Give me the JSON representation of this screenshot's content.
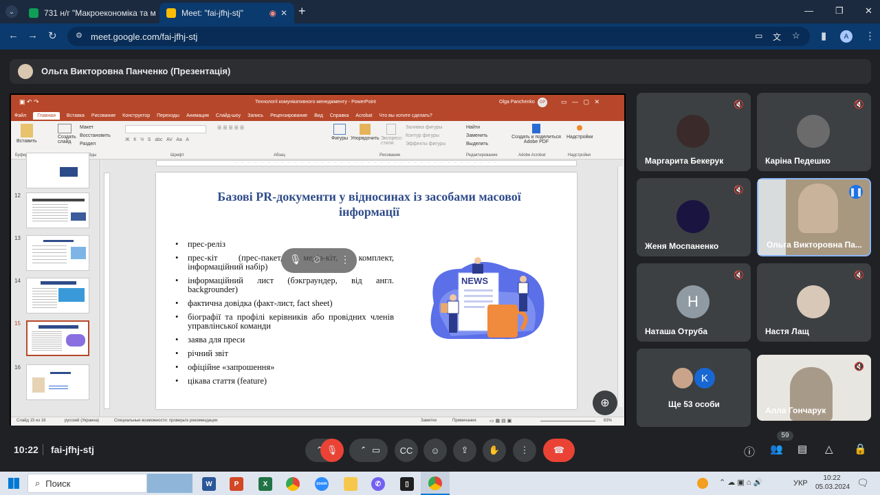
{
  "browser": {
    "tabs": [
      {
        "title": "731 н/г \"Макроекономіка та м",
        "close": "✕"
      },
      {
        "title": "Meet: \"fai-jfhj-stj\"",
        "close": "✕"
      }
    ],
    "new_tab": "+",
    "url": "meet.google.com/fai-jfhj-stj",
    "profile_initial": "A",
    "win_controls": [
      "—",
      "❐",
      "✕"
    ]
  },
  "meet": {
    "presenter_label": "Ольга Викторовна Панченко (Презентація)",
    "time": "10:22",
    "meeting_code": "fai-jfhj-stj",
    "participants_count": "59"
  },
  "ppt": {
    "title": "Технології комунікативного менеджменту  -  PowerPoint",
    "user": "Olga Panchenko",
    "user_initials": "OP",
    "menu": [
      "Файл",
      "Главная",
      "Вставка",
      "Рисование",
      "Конструктор",
      "Переходы",
      "Анимация",
      "Слайд-шоу",
      "Запись",
      "Рецензирование",
      "Вид",
      "Справка",
      "Acrobat",
      "Что вы хотите сделать?"
    ],
    "ribbon": {
      "paste": "Вставить",
      "create_slide": "Создать слайд",
      "layout": "Макет",
      "restore": "Восстановить",
      "section": "Раздел",
      "clipboard": "Буфер обмена",
      "slides": "Слайды",
      "font": "Шрифт",
      "paragraph": "Абзац",
      "figures": "Фигуры",
      "arrange": "Упорядочить",
      "express_styles": "Экспресс-стили",
      "fill": "Заливка фигуры",
      "outline": "Контур фигуры",
      "effects": "Эффекты фигуры",
      "drawing": "Рисование",
      "find": "Найти",
      "replace": "Заменить",
      "select": "Выделить",
      "editing": "Редактирование",
      "create_pdf": "Создать и поделиться Adobe PDF",
      "adobe": "Adobe Acrobat",
      "addins": "Надстройки",
      "addins_group": "Надстройки"
    },
    "thumb_numbers": [
      "12",
      "13",
      "14",
      "15",
      "16"
    ],
    "slide": {
      "title": "Базові PR-документи у відносинах із засобами масової інформації",
      "bullets": [
        "прес-реліз",
        "прес-кіт (прес-пакет, медіа-кіт, комплект, інформаційний набір)",
        "інформаційний лист (бэкграундер, від англ. backgrounder)",
        "фактична довідка (факт-лист, fact sheet)",
        "біографії та профілі керівників або провідних членів управлінської команди",
        "заява для преси",
        "річний звіт",
        "офіційне «запрошення»",
        "цікава стаття (feature)"
      ],
      "news_label": "NEWS"
    },
    "status": {
      "slide_of": "Слайд 15 из 16",
      "language": "русский (Украина)",
      "accessibility": "Специальные возможности: проверьте рекомендации",
      "notes": "Заметки",
      "comments": "Примечания",
      "zoom": "83%"
    }
  },
  "participants": [
    {
      "name": "Маргарита Бекерук",
      "avatar_color": "#3a2a2a"
    },
    {
      "name": "Каріна Педешко",
      "avatar_color": "#6b6b6b"
    },
    {
      "name": "Женя Моспаненко",
      "avatar_color": "#1a1440"
    },
    {
      "name": "Ольга Викторовна Па...",
      "avatar_color": "#c9b39a"
    },
    {
      "name": "Наташа Отруба",
      "initial": "Н",
      "avatar_color": "#8f9aa3"
    },
    {
      "name": "Настя Лащ",
      "avatar_color": "#d8c8b8"
    },
    {
      "name": "Ще 53 особи",
      "initial": "K",
      "avatar_color": "#1967d2"
    },
    {
      "name": "Алла Гончарук",
      "avatar_color": "#a89a88"
    }
  ],
  "taskbar": {
    "search": "Поиск",
    "language": "УКР",
    "time": "10:22",
    "date": "05.03.2024"
  }
}
